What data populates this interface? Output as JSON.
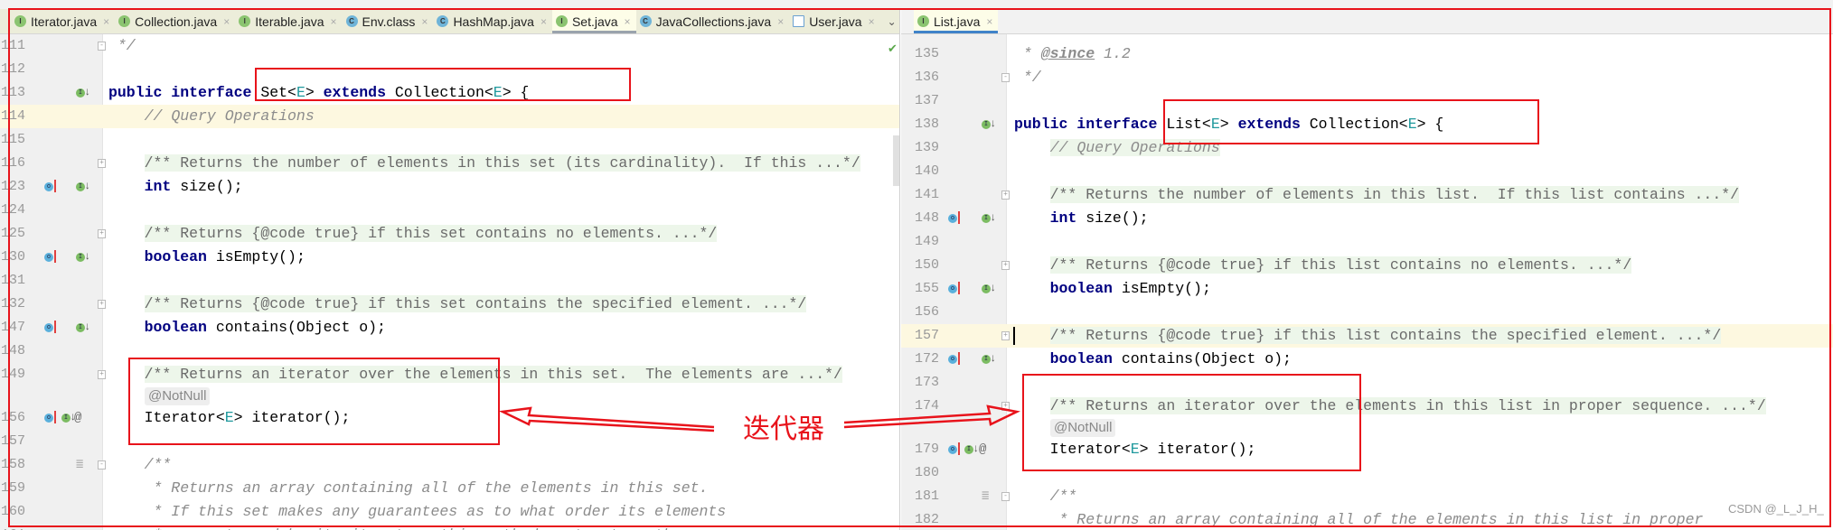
{
  "left_editor": {
    "tabs": [
      {
        "label": "Iterator.java",
        "icon": "interface-icon",
        "active": false
      },
      {
        "label": "Collection.java",
        "icon": "interface-icon",
        "active": false
      },
      {
        "label": "Iterable.java",
        "icon": "interface-icon",
        "active": false
      },
      {
        "label": "Env.class",
        "icon": "class-icon",
        "active": false
      },
      {
        "label": "HashMap.java",
        "icon": "class-icon",
        "active": false
      },
      {
        "label": "Set.java",
        "icon": "interface-icon",
        "active": true
      },
      {
        "label": "JavaCollections.java",
        "icon": "class-icon",
        "active": false
      },
      {
        "label": "User.java",
        "icon": "file-icon",
        "active": false
      }
    ],
    "lines": [
      {
        "n": "111",
        "fold": "end",
        "tokens": [
          [
            " */",
            "comment"
          ]
        ]
      },
      {
        "n": "112",
        "tokens": []
      },
      {
        "n": "113",
        "icons": [
          "impl"
        ],
        "tokens": [
          [
            "public interface ",
            "keyword"
          ],
          [
            "Set<",
            "text"
          ],
          [
            "E",
            "type-param"
          ],
          [
            "> ",
            "text"
          ],
          [
            "extends ",
            "keyword"
          ],
          [
            "Collection<",
            "text"
          ],
          [
            "E",
            "type-param"
          ],
          [
            "> {",
            "text"
          ]
        ]
      },
      {
        "n": "114",
        "current": true,
        "tokens": [
          [
            "    ",
            "text"
          ],
          [
            "// Query Operations",
            "comment"
          ]
        ]
      },
      {
        "n": "115",
        "tokens": []
      },
      {
        "n": "116",
        "fold": "plus",
        "tokens": [
          [
            "    ",
            "text"
          ],
          [
            "/** Returns the number of elements in this set (its cardinality).  If this ...*/",
            "doc"
          ]
        ]
      },
      {
        "n": "123",
        "icons": [
          "over",
          "impl"
        ],
        "tokens": [
          [
            "    ",
            "text"
          ],
          [
            "int ",
            "keyword"
          ],
          [
            "size();",
            "text"
          ]
        ]
      },
      {
        "n": "124",
        "tokens": []
      },
      {
        "n": "125",
        "fold": "plus",
        "tokens": [
          [
            "    ",
            "text"
          ],
          [
            "/** Returns {@code true} if this set contains no elements. ...*/",
            "doc"
          ]
        ]
      },
      {
        "n": "130",
        "icons": [
          "over",
          "impl"
        ],
        "tokens": [
          [
            "    ",
            "text"
          ],
          [
            "boolean ",
            "keyword"
          ],
          [
            "isEmpty();",
            "text"
          ]
        ]
      },
      {
        "n": "131",
        "tokens": []
      },
      {
        "n": "132",
        "fold": "plus",
        "tokens": [
          [
            "    ",
            "text"
          ],
          [
            "/** Returns {@code true} if this set contains the specified element. ...*/",
            "doc"
          ]
        ]
      },
      {
        "n": "147",
        "icons": [
          "over",
          "impl"
        ],
        "tokens": [
          [
            "    ",
            "text"
          ],
          [
            "boolean ",
            "keyword"
          ],
          [
            "contains(Object o);",
            "text"
          ]
        ]
      },
      {
        "n": "148",
        "tokens": []
      },
      {
        "n": "149",
        "fold": "plus",
        "tokens": [
          [
            "    ",
            "text"
          ],
          [
            "/** Returns an iterator over the elements in this set.  The elements are ...*/",
            "doc"
          ]
        ]
      },
      {
        "inlay": "@NotNull"
      },
      {
        "n": "156",
        "icons": [
          "over",
          "impl",
          "at"
        ],
        "tokens": [
          [
            "    ",
            "text"
          ],
          [
            "Iterator<",
            "text"
          ],
          [
            "E",
            "type-param"
          ],
          [
            "> iterator();",
            "text"
          ]
        ]
      },
      {
        "n": "157",
        "tokens": []
      },
      {
        "n": "158",
        "fold": "minus",
        "docicon": true,
        "tokens": [
          [
            "    /**",
            "comment"
          ]
        ]
      },
      {
        "n": "159",
        "tokens": [
          [
            "     * Returns an array containing all of the elements in this set.",
            "comment"
          ]
        ]
      },
      {
        "n": "160",
        "tokens": [
          [
            "     * If this set makes any guarantees as to what order its elements",
            "comment"
          ]
        ]
      },
      {
        "n": "161",
        "tokens": [
          [
            "     * are returned by its iterator, this method must return the",
            "comment"
          ]
        ]
      }
    ]
  },
  "right_editor": {
    "tabs": [
      {
        "label": "List.java",
        "icon": "interface-icon",
        "active": true
      }
    ],
    "lines": [
      {
        "n": "135",
        "tokens": [
          [
            " * ",
            "comment"
          ],
          [
            "@since",
            "doctag"
          ],
          [
            " 1.2",
            "comment"
          ]
        ]
      },
      {
        "n": "136",
        "fold": "end",
        "tokens": [
          [
            " */",
            "comment"
          ]
        ]
      },
      {
        "n": "137",
        "tokens": []
      },
      {
        "n": "138",
        "icons": [
          "impl"
        ],
        "tokens": [
          [
            "public interface ",
            "keyword"
          ],
          [
            "List<",
            "text"
          ],
          [
            "E",
            "type-param"
          ],
          [
            "> ",
            "text"
          ],
          [
            "extends ",
            "keyword"
          ],
          [
            "Collection<",
            "text"
          ],
          [
            "E",
            "type-param"
          ],
          [
            "> {",
            "text"
          ]
        ]
      },
      {
        "n": "139",
        "tokens": [
          [
            "    ",
            "text"
          ],
          [
            "// Query Operations",
            "commentbg"
          ]
        ]
      },
      {
        "n": "140",
        "tokens": []
      },
      {
        "n": "141",
        "fold": "plus",
        "tokens": [
          [
            "    ",
            "text"
          ],
          [
            "/** Returns the number of elements in this list.  If this list contains ...*/",
            "doc"
          ]
        ]
      },
      {
        "n": "148",
        "icons": [
          "over",
          "impl"
        ],
        "tokens": [
          [
            "    ",
            "text"
          ],
          [
            "int ",
            "keyword"
          ],
          [
            "size();",
            "text"
          ]
        ]
      },
      {
        "n": "149",
        "tokens": []
      },
      {
        "n": "150",
        "fold": "plus",
        "tokens": [
          [
            "    ",
            "text"
          ],
          [
            "/** Returns {@code true} if this list contains no elements. ...*/",
            "doc"
          ]
        ]
      },
      {
        "n": "155",
        "icons": [
          "over",
          "impl"
        ],
        "tokens": [
          [
            "    ",
            "text"
          ],
          [
            "boolean ",
            "keyword"
          ],
          [
            "isEmpty();",
            "text"
          ]
        ]
      },
      {
        "n": "156",
        "tokens": []
      },
      {
        "n": "157",
        "fold": "plus",
        "current": true,
        "caret": true,
        "tokens": [
          [
            "    ",
            "text"
          ],
          [
            "/** Returns {@code true} if this list contains the specified element. ...*/",
            "doc"
          ]
        ]
      },
      {
        "n": "172",
        "icons": [
          "over",
          "impl"
        ],
        "tokens": [
          [
            "    ",
            "text"
          ],
          [
            "boolean ",
            "keyword"
          ],
          [
            "contains(Object o);",
            "text"
          ]
        ]
      },
      {
        "n": "173",
        "tokens": []
      },
      {
        "n": "174",
        "fold": "plus",
        "tokens": [
          [
            "    ",
            "text"
          ],
          [
            "/** Returns an iterator over the elements in this list in proper sequence. ...*/",
            "doc"
          ]
        ]
      },
      {
        "inlay": "@NotNull"
      },
      {
        "n": "179",
        "icons": [
          "over",
          "impl",
          "at"
        ],
        "tokens": [
          [
            "    ",
            "text"
          ],
          [
            "Iterator<",
            "text"
          ],
          [
            "E",
            "type-param"
          ],
          [
            "> iterator();",
            "text"
          ]
        ]
      },
      {
        "n": "180",
        "tokens": []
      },
      {
        "n": "181",
        "fold": "minus",
        "docicon": true,
        "tokens": [
          [
            "    /**",
            "comment"
          ]
        ]
      },
      {
        "n": "182",
        "tokens": [
          [
            "     * Returns an array containing all of the elements in this list in proper",
            "comment"
          ]
        ]
      }
    ]
  },
  "annotation": {
    "label": "迭代器",
    "color": "#e8131b"
  },
  "watermark": "CSDN @_L_J_H_",
  "colors": {
    "keyword": "#000080",
    "type_param": "#20999d",
    "comment": "#8c8c8c",
    "folded_doc_bg": "#edf6ea",
    "current_line": "#fdf8e0",
    "active_tab_underline": "#4083c9"
  }
}
